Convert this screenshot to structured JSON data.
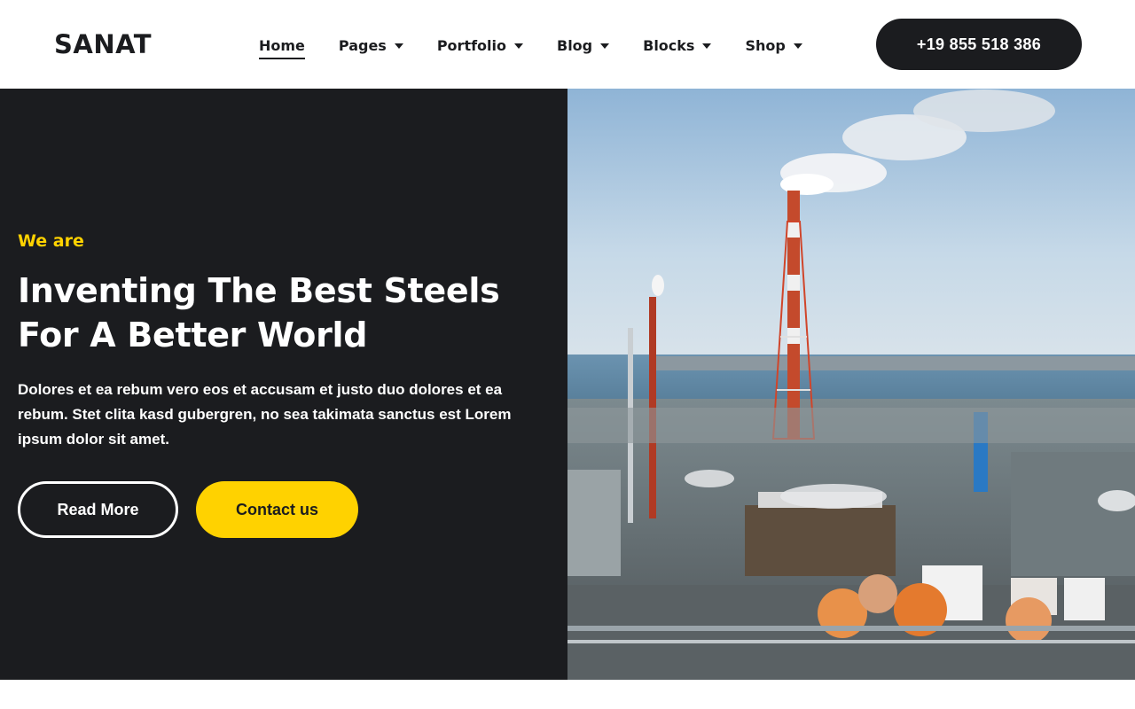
{
  "header": {
    "logo": "SANAT",
    "nav": [
      {
        "label": "Home",
        "active": true,
        "dropdown": false
      },
      {
        "label": "Pages",
        "active": false,
        "dropdown": true
      },
      {
        "label": "Portfolio",
        "active": false,
        "dropdown": true
      },
      {
        "label": "Blog",
        "active": false,
        "dropdown": true
      },
      {
        "label": "Blocks",
        "active": false,
        "dropdown": true
      },
      {
        "label": "Shop",
        "active": false,
        "dropdown": true
      }
    ],
    "phone": "+19 855 518 386"
  },
  "hero": {
    "eyebrow": "We are",
    "headline_line1": "Inventing The Best Steels",
    "headline_line2": "For A Better World",
    "description": "Dolores et ea rebum vero eos et accusam et justo duo dolores et ea rebum. Stet clita kasd gubergren, no sea takimata sanctus est Lorem ipsum dolor sit amet.",
    "read_more_label": "Read More",
    "contact_label": "Contact us",
    "image_icon": "industrial-plant-photo"
  },
  "colors": {
    "dark": "#1b1c1f",
    "accent": "#ffd200",
    "white": "#ffffff"
  }
}
